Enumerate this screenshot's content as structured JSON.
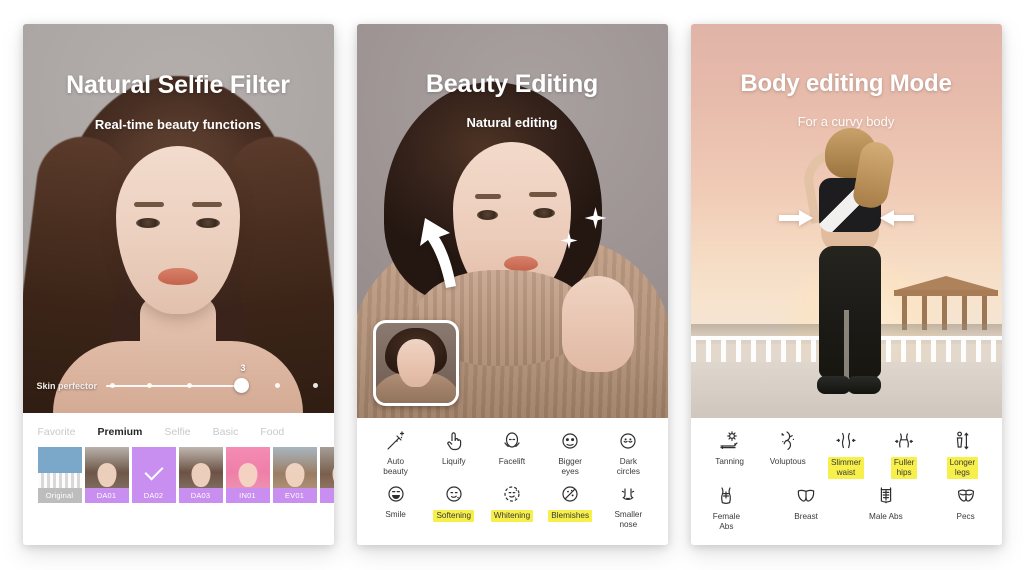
{
  "screens": [
    {
      "id": "natural-selfie-filter",
      "title": "Natural Selfie Filter",
      "subtitle": "Real-time beauty functions",
      "slider": {
        "label": "Skin perfector",
        "value": "3"
      },
      "tabs": [
        {
          "label": "Favorite",
          "active": false
        },
        {
          "label": "Premium",
          "active": true
        },
        {
          "label": "Selfie",
          "active": false
        },
        {
          "label": "Basic",
          "active": false
        },
        {
          "label": "Food",
          "active": false
        }
      ],
      "filters": [
        {
          "label": "Original",
          "selected": false,
          "kind": "original"
        },
        {
          "label": "DA01",
          "selected": false,
          "kind": "portrait"
        },
        {
          "label": "DA02",
          "selected": true,
          "kind": "selected"
        },
        {
          "label": "DA03",
          "selected": false,
          "kind": "portrait"
        },
        {
          "label": "IN01",
          "selected": false,
          "kind": "pink"
        },
        {
          "label": "EV01",
          "selected": false,
          "kind": "portrait"
        },
        {
          "label": "E",
          "selected": false,
          "kind": "portrait"
        }
      ]
    },
    {
      "id": "beauty-editing",
      "title": "Beauty Editing",
      "subtitle": "Natural editing",
      "tools_row1": [
        {
          "label": "Auto\nbeauty",
          "icon": "magic-wand-icon",
          "highlight": false
        },
        {
          "label": "Liquify",
          "icon": "pointing-hand-icon",
          "highlight": false
        },
        {
          "label": "Facelift",
          "icon": "face-slim-icon",
          "highlight": false
        },
        {
          "label": "Bigger\neyes",
          "icon": "bigger-eyes-icon",
          "highlight": false
        },
        {
          "label": "Dark\ncircles",
          "icon": "dark-circles-icon",
          "highlight": false
        }
      ],
      "tools_row2": [
        {
          "label": "Smile",
          "icon": "smile-icon",
          "highlight": false
        },
        {
          "label": "Softening",
          "icon": "softening-icon",
          "highlight": true
        },
        {
          "label": "Whitening",
          "icon": "whitening-icon",
          "highlight": true
        },
        {
          "label": "Blemishes",
          "icon": "blemishes-icon",
          "highlight": true
        },
        {
          "label": "Smaller\nnose",
          "icon": "nose-icon",
          "highlight": false
        }
      ]
    },
    {
      "id": "body-editing-mode",
      "title": "Body editing Mode",
      "subtitle": "For a curvy body",
      "tools_row1": [
        {
          "label": "Tanning",
          "icon": "sun-lounger-icon",
          "highlight": false
        },
        {
          "label": "Voluptous",
          "icon": "voluptuous-icon",
          "highlight": false
        },
        {
          "label": "Slimmer\nwaist",
          "icon": "slimmer-waist-icon",
          "highlight": true
        },
        {
          "label": "Fuller\nhips",
          "icon": "fuller-hips-icon",
          "highlight": true
        },
        {
          "label": "Longer\nlegs",
          "icon": "longer-legs-icon",
          "highlight": true
        }
      ],
      "tools_row2": [
        {
          "label": "Female\nAbs",
          "icon": "female-abs-icon",
          "highlight": false
        },
        {
          "label": "Breast",
          "icon": "breast-icon",
          "highlight": false
        },
        {
          "label": "Male Abs",
          "icon": "male-abs-icon",
          "highlight": false
        },
        {
          "label": "Pecs",
          "icon": "pecs-icon",
          "highlight": false
        }
      ]
    }
  ],
  "colors": {
    "highlight_yellow": "#f7ef4a",
    "filter_purple": "#c88ef0",
    "original_grey": "#bdbdbd",
    "page_background": "#ffffff",
    "active_tab": "#262626",
    "inactive_tab": "#c9c9c9"
  }
}
